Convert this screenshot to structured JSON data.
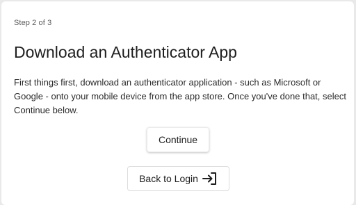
{
  "step": {
    "label": "Step 2 of 3"
  },
  "page": {
    "title": "Download an Authenticator App",
    "description": "First things first, download an authenticator application - such as Microsoft or Google - onto your mobile device from the app store. Once you've done that, select Continue below."
  },
  "actions": {
    "continue_label": "Continue",
    "back_label": "Back to Login",
    "back_icon": "login-arrow-icon"
  }
}
